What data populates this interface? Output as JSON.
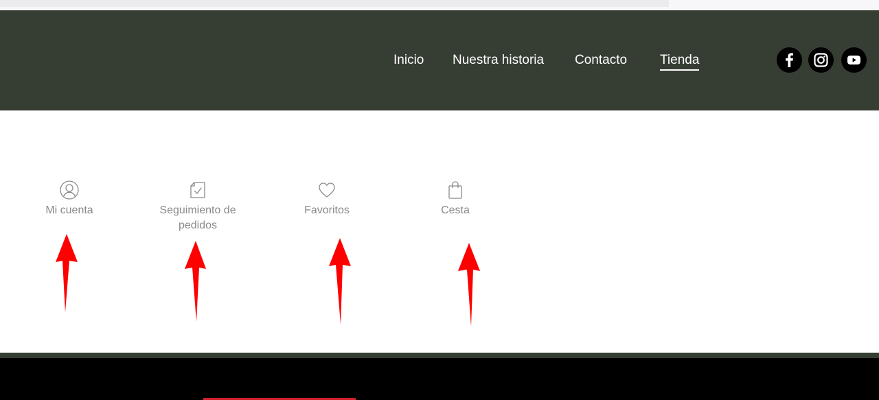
{
  "nav": {
    "items": [
      {
        "label": "Inicio",
        "active": false
      },
      {
        "label": "Nuestra historia",
        "active": false
      },
      {
        "label": "Contacto",
        "active": false
      },
      {
        "label": "Tienda",
        "active": true
      }
    ],
    "social": [
      {
        "icon": "facebook-icon"
      },
      {
        "icon": "instagram-icon"
      },
      {
        "icon": "youtube-icon"
      }
    ]
  },
  "account": {
    "items": [
      {
        "label": "Mi cuenta",
        "icon": "user-icon"
      },
      {
        "label": "Seguimiento de pedidos",
        "icon": "order-tracking-icon"
      },
      {
        "label": "Favoritos",
        "icon": "heart-icon"
      },
      {
        "label": "Cesta",
        "icon": "shopping-bag-icon"
      }
    ]
  },
  "colors": {
    "header_bg": "#363d33",
    "nav_text": "#ffffff",
    "item_text": "#8a8a8a",
    "annotation_arrow": "#ff0000",
    "footer_bg": "#000000"
  }
}
